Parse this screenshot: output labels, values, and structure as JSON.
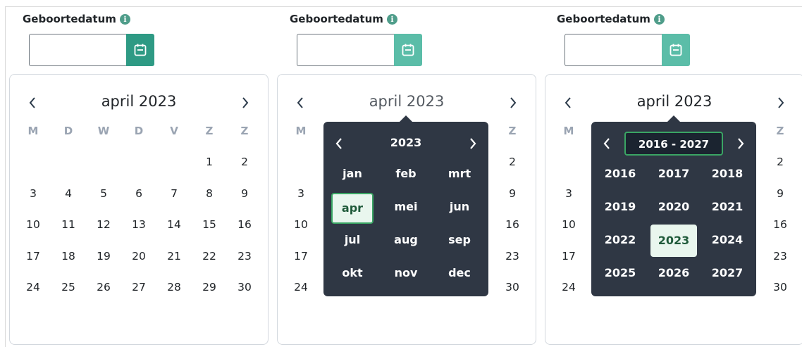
{
  "colors": {
    "accent": "#2e9a84",
    "accent_light": "#5bbda8",
    "popup_bg": "#2f3744",
    "selected_bg": "#e9f6ee",
    "selected_border": "#3aa564"
  },
  "fields": [
    {
      "label": "Geboortedatum",
      "info_icon": "info-icon",
      "value": "",
      "button_icon": "calendar-icon"
    },
    {
      "label": "Geboortedatum",
      "info_icon": "info-icon",
      "value": "",
      "button_icon": "calendar-icon"
    },
    {
      "label": "Geboortedatum",
      "info_icon": "info-icon",
      "value": "",
      "button_icon": "calendar-icon"
    }
  ],
  "calendar": {
    "title": "april 2023",
    "weekdays": [
      "M",
      "D",
      "W",
      "D",
      "V",
      "Z",
      "Z"
    ],
    "weeks": [
      [
        "",
        "",
        "",
        "",
        "",
        "1",
        "2"
      ],
      [
        "3",
        "4",
        "5",
        "6",
        "7",
        "8",
        "9"
      ],
      [
        "10",
        "11",
        "12",
        "13",
        "14",
        "15",
        "16"
      ],
      [
        "17",
        "18",
        "19",
        "20",
        "21",
        "22",
        "23"
      ],
      [
        "24",
        "25",
        "26",
        "27",
        "28",
        "29",
        "30"
      ]
    ]
  },
  "month_picker": {
    "year": "2023",
    "months": [
      "jan",
      "feb",
      "mrt",
      "apr",
      "mei",
      "jun",
      "jul",
      "aug",
      "sep",
      "okt",
      "nov",
      "dec"
    ],
    "selected": "apr"
  },
  "year_picker": {
    "range": "2016 - 2027",
    "years": [
      "2016",
      "2017",
      "2018",
      "2019",
      "2020",
      "2021",
      "2022",
      "2023",
      "2024",
      "2025",
      "2026",
      "2027"
    ],
    "selected": "2023"
  }
}
